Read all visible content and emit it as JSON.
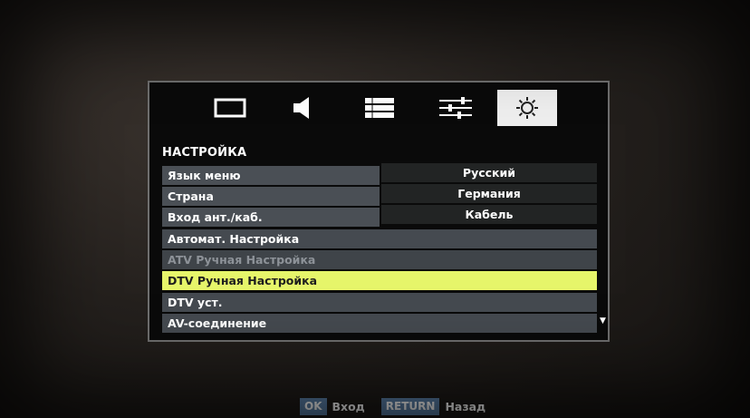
{
  "menu": {
    "tabs": [
      {
        "name": "picture-icon",
        "active": false
      },
      {
        "name": "sound-icon",
        "active": false
      },
      {
        "name": "channel-list-icon",
        "active": false
      },
      {
        "name": "options-sliders-icon",
        "active": false
      },
      {
        "name": "settings-sun-icon",
        "active": true
      }
    ],
    "heading": "НАСТРОЙКА",
    "setting_rows": [
      {
        "label": "Язык меню",
        "value": "Русский"
      },
      {
        "label": "Страна",
        "value": "Германия"
      },
      {
        "label": "Вход ант./каб.",
        "value": "Кабель"
      }
    ],
    "action_rows": [
      {
        "label": "Автомат. Настройка",
        "state": "normal"
      },
      {
        "label": "ATV Ручная Настройка",
        "state": "disabled"
      },
      {
        "label": "DTV Ручная Настройка",
        "state": "selected"
      },
      {
        "label": "DTV уст.",
        "state": "normal"
      },
      {
        "label": "AV-соединение",
        "state": "normal"
      }
    ],
    "scroll_indicator": "▼"
  },
  "legend": {
    "ok_key": "OK",
    "ok_text": "Вход",
    "return_key": "RETURN",
    "return_text": "Назад"
  },
  "colors": {
    "selected_row": "#e6f56a",
    "active_tab": "#eeeeee",
    "key_badge": "#5a7fa6"
  }
}
